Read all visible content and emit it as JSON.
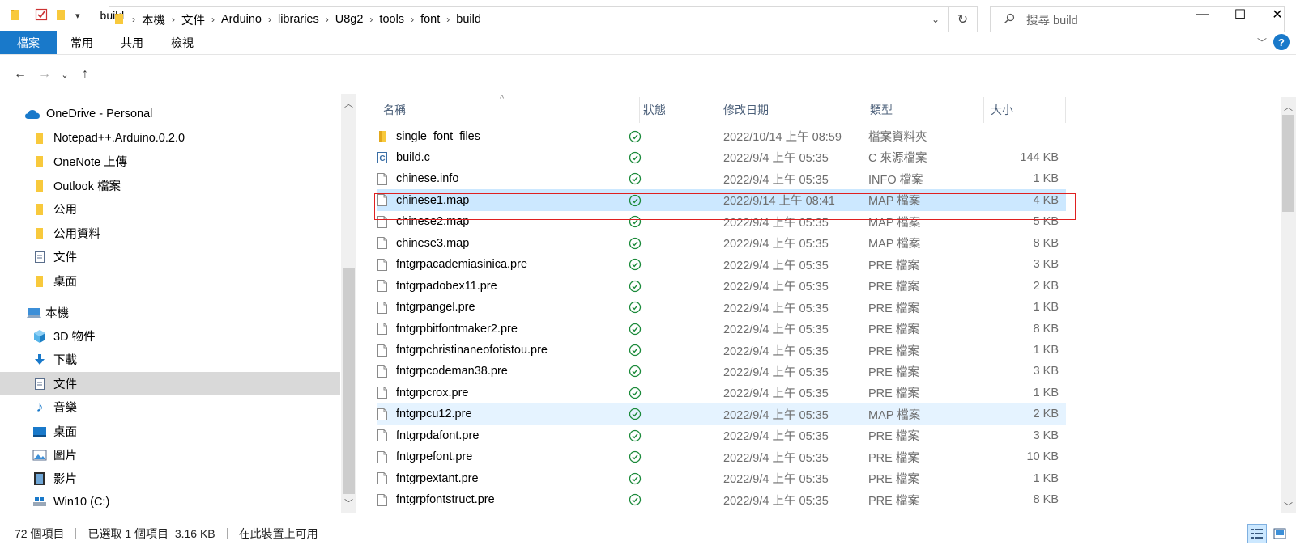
{
  "window": {
    "title": "build",
    "minimize": "—",
    "maximize": "☐",
    "close": "✕"
  },
  "ribbon": {
    "tabs": [
      "檔案",
      "常用",
      "共用",
      "檢視"
    ],
    "help": "?"
  },
  "address": {
    "crumbs": [
      "本機",
      "文件",
      "Arduino",
      "libraries",
      "U8g2",
      "tools",
      "font",
      "build"
    ],
    "search_placeholder": "搜尋 build"
  },
  "nav": {
    "items": [
      {
        "label": "OneDrive - Personal",
        "icon": "cloud-icon",
        "indent": 0
      },
      {
        "label": "Notepad++.Arduino.0.2.0",
        "icon": "folder-icon",
        "indent": 1
      },
      {
        "label": "OneNote 上傳",
        "icon": "folder-icon",
        "indent": 1
      },
      {
        "label": "Outlook 檔案",
        "icon": "folder-icon",
        "indent": 1
      },
      {
        "label": "公用",
        "icon": "folder-icon",
        "indent": 1
      },
      {
        "label": "公用資料",
        "icon": "folder-icon",
        "indent": 1
      },
      {
        "label": "文件",
        "icon": "document-icon",
        "indent": 1
      },
      {
        "label": "桌面",
        "icon": "folder-icon",
        "indent": 1
      },
      {
        "label": "本機",
        "icon": "computer-icon",
        "indent": 0
      },
      {
        "label": "3D 物件",
        "icon": "3d-objects-icon",
        "indent": 1
      },
      {
        "label": "下載",
        "icon": "download-icon",
        "indent": 1
      },
      {
        "label": "文件",
        "icon": "document-icon",
        "indent": 1,
        "selected": true
      },
      {
        "label": "音樂",
        "icon": "music-icon",
        "indent": 1
      },
      {
        "label": "桌面",
        "icon": "desktop-icon",
        "indent": 1
      },
      {
        "label": "圖片",
        "icon": "pictures-icon",
        "indent": 1
      },
      {
        "label": "影片",
        "icon": "videos-icon",
        "indent": 1
      },
      {
        "label": "Win10 (C:)",
        "icon": "drive-icon",
        "indent": 1
      }
    ]
  },
  "columns": {
    "name": "名稱",
    "status": "狀態",
    "modified": "修改日期",
    "type": "類型",
    "size": "大小"
  },
  "files": [
    {
      "name": "single_font_files",
      "icon": "folder-icon",
      "modified": "2022/10/14 上午 08:59",
      "type": "檔案資料夾",
      "size": ""
    },
    {
      "name": "build.c",
      "icon": "c-file-icon",
      "modified": "2022/9/4 上午 05:35",
      "type": "C 來源檔案",
      "size": "144 KB"
    },
    {
      "name": "chinese.info",
      "icon": "file-icon",
      "modified": "2022/9/4 上午 05:35",
      "type": "INFO 檔案",
      "size": "1 KB"
    },
    {
      "name": "chinese1.map",
      "icon": "file-icon",
      "modified": "2022/9/14 上午 08:41",
      "type": "MAP 檔案",
      "size": "4 KB",
      "selected": true
    },
    {
      "name": "chinese2.map",
      "icon": "file-icon",
      "modified": "2022/9/4 上午 05:35",
      "type": "MAP 檔案",
      "size": "5 KB"
    },
    {
      "name": "chinese3.map",
      "icon": "file-icon",
      "modified": "2022/9/4 上午 05:35",
      "type": "MAP 檔案",
      "size": "8 KB"
    },
    {
      "name": "fntgrpacademiasinica.pre",
      "icon": "file-icon",
      "modified": "2022/9/4 上午 05:35",
      "type": "PRE 檔案",
      "size": "3 KB"
    },
    {
      "name": "fntgrpadobex11.pre",
      "icon": "file-icon",
      "modified": "2022/9/4 上午 05:35",
      "type": "PRE 檔案",
      "size": "2 KB"
    },
    {
      "name": "fntgrpangel.pre",
      "icon": "file-icon",
      "modified": "2022/9/4 上午 05:35",
      "type": "PRE 檔案",
      "size": "1 KB"
    },
    {
      "name": "fntgrpbitfontmaker2.pre",
      "icon": "file-icon",
      "modified": "2022/9/4 上午 05:35",
      "type": "PRE 檔案",
      "size": "8 KB"
    },
    {
      "name": "fntgrpchristinaneofotistou.pre",
      "icon": "file-icon",
      "modified": "2022/9/4 上午 05:35",
      "type": "PRE 檔案",
      "size": "1 KB"
    },
    {
      "name": "fntgrpcodeman38.pre",
      "icon": "file-icon",
      "modified": "2022/9/4 上午 05:35",
      "type": "PRE 檔案",
      "size": "3 KB"
    },
    {
      "name": "fntgrpcrox.pre",
      "icon": "file-icon",
      "modified": "2022/9/4 上午 05:35",
      "type": "PRE 檔案",
      "size": "1 KB"
    },
    {
      "name": "fntgrpcu12.pre",
      "icon": "file-icon",
      "modified": "2022/9/4 上午 05:35",
      "type": "MAP 檔案",
      "size": "2 KB",
      "hover": true
    },
    {
      "name": "fntgrpdafont.pre",
      "icon": "file-icon",
      "modified": "2022/9/4 上午 05:35",
      "type": "PRE 檔案",
      "size": "3 KB"
    },
    {
      "name": "fntgrpefont.pre",
      "icon": "file-icon",
      "modified": "2022/9/4 上午 05:35",
      "type": "PRE 檔案",
      "size": "10 KB"
    },
    {
      "name": "fntgrpextant.pre",
      "icon": "file-icon",
      "modified": "2022/9/4 上午 05:35",
      "type": "PRE 檔案",
      "size": "1 KB"
    },
    {
      "name": "fntgrpfontstruct.pre",
      "icon": "file-icon",
      "modified": "2022/9/4 上午 05:35",
      "type": "PRE 檔案",
      "size": "8 KB"
    }
  ],
  "status": {
    "count": "72 個項目",
    "selection": "已選取 1 個項目  3.16 KB",
    "availability": "在此裝置上可用"
  },
  "colors": {
    "accent": "#1979ca",
    "selected_row": "#cce8ff",
    "hover_row": "#e5f3ff",
    "sync_green": "#1b8a3a",
    "highlight_box": "#e02020",
    "folder_yellow": "#f8c93c"
  }
}
